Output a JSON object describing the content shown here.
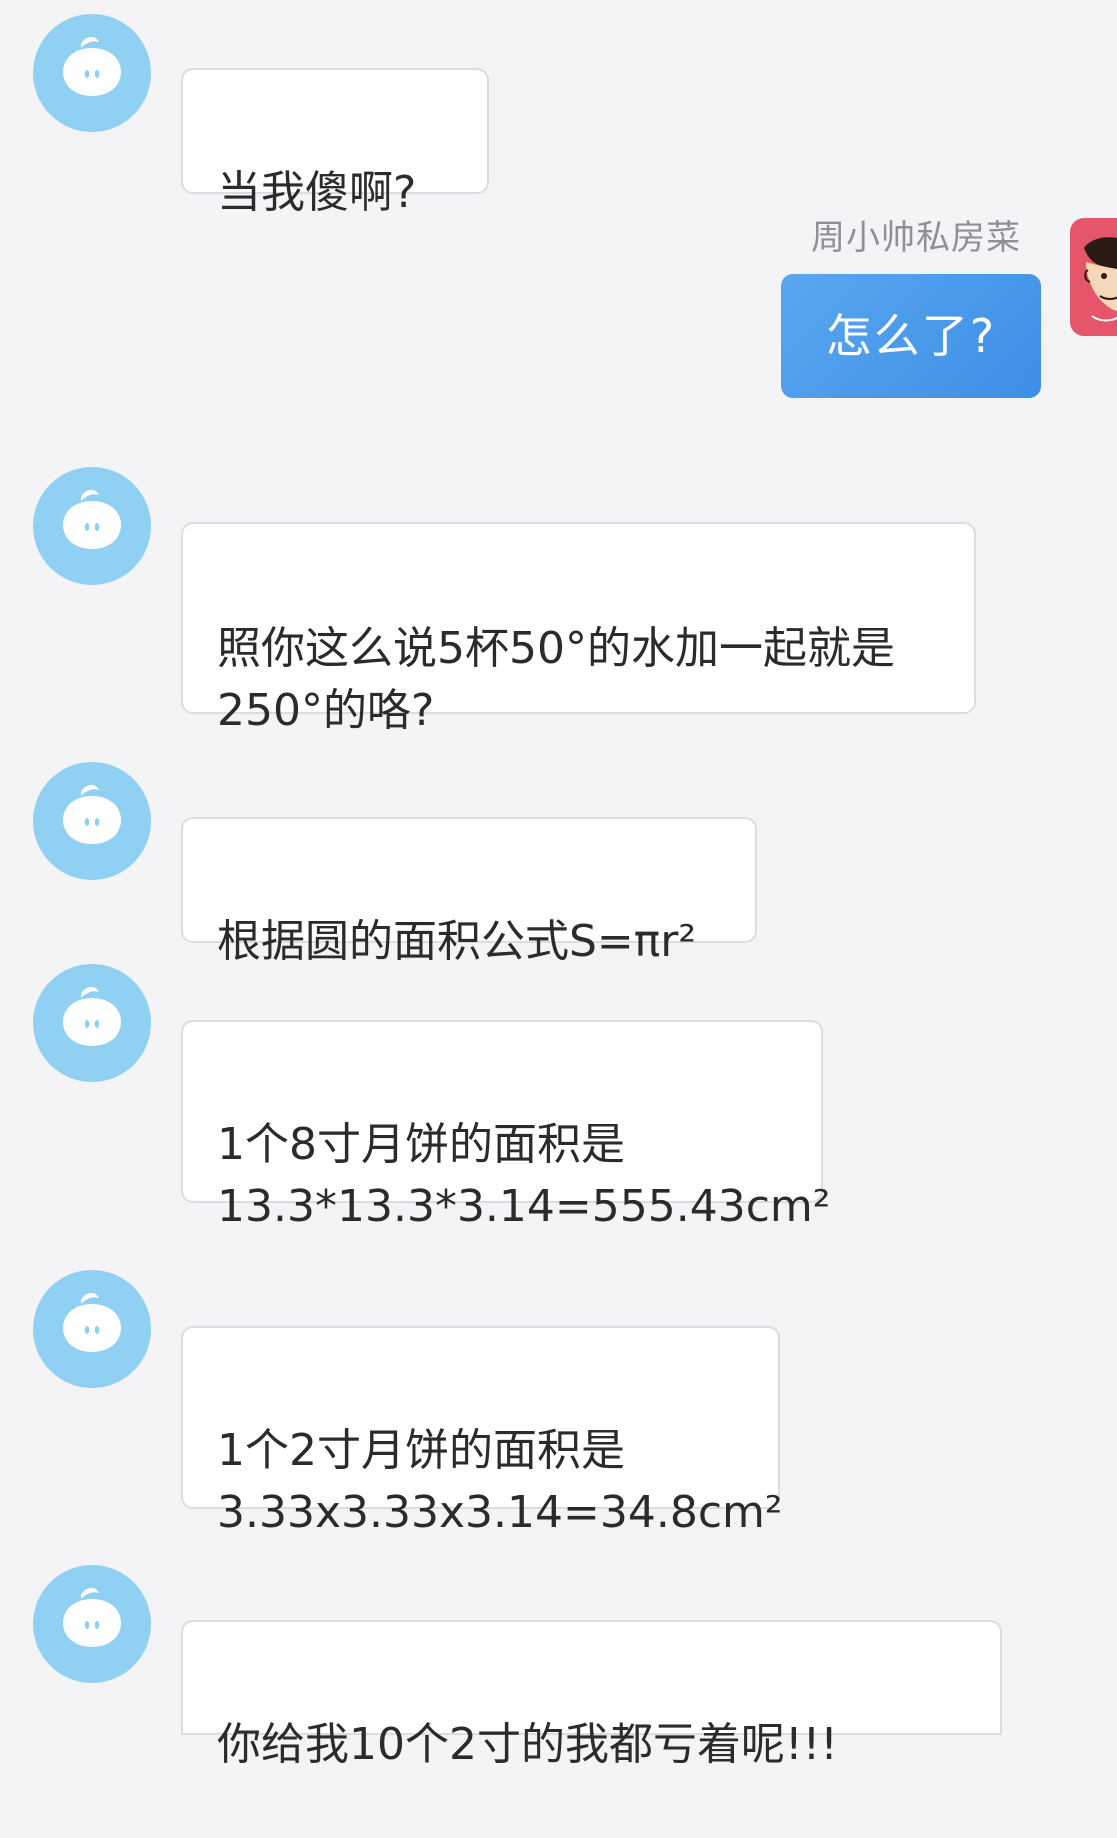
{
  "conversation": {
    "messages": [
      {
        "text": "当我傻啊?"
      },
      {
        "sender": "周小帅私房菜",
        "text": "怎么了?"
      },
      {
        "text": "照你这么说5杯50°的水加一起就是\n250°的咯?"
      },
      {
        "text": "根据圆的面积公式S=πr²"
      },
      {
        "text": "1个8寸月饼的面积是\n13.3*13.3*3.14=555.43cm²"
      },
      {
        "text": "1个2寸月饼的面积是\n3.33x3.33x3.14=34.8cm²"
      },
      {
        "text": "你给我10个2寸的我都亏着呢!!!"
      }
    ]
  },
  "icons": {
    "cs_avatar": "chat-bubble-face-icon",
    "user_avatar": "cartoon-face-avatar"
  },
  "colors": {
    "background": "#f4f4f7",
    "cs_avatar": "#8fd0f3",
    "outgoing_bubble": "#4797ea",
    "user_avatar": "#e5566a"
  }
}
